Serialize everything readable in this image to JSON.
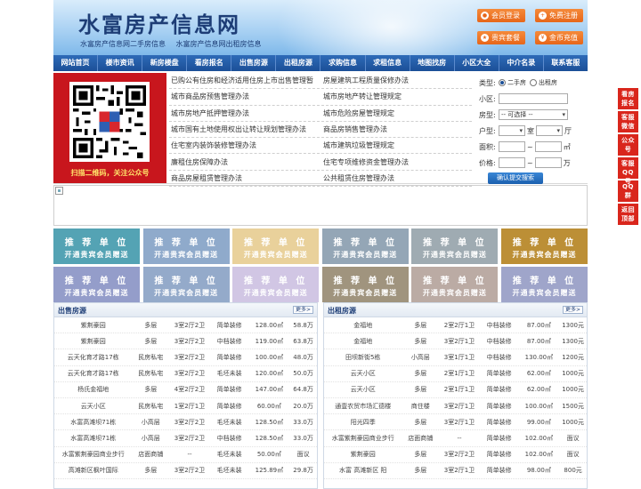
{
  "header": {
    "site_name": "水富房产信息网",
    "taglines": [
      "水富房产信息网二手房信息",
      "水富房产信息网出租房信息"
    ],
    "buttons": [
      {
        "label": "会员登录",
        "icon": "user-icon"
      },
      {
        "label": "免费注册",
        "icon": "register-icon"
      },
      {
        "label": "贵宾套餐",
        "icon": "vip-icon"
      },
      {
        "label": "金币充值",
        "icon": "coin-icon"
      }
    ]
  },
  "nav": [
    "网站首页",
    "楼市资讯",
    "新房楼盘",
    "看房报名",
    "出售房源",
    "出租房源",
    "求购信息",
    "求租信息",
    "地图找房",
    "小区大全",
    "中介名录",
    "联系客服"
  ],
  "qr": {
    "caption": "扫描二维码，关注公众号"
  },
  "links": [
    [
      "已购公有住房和经济适用住房上市出售管理暂",
      "房屋建筑工程质量保修办法"
    ],
    [
      "城市商品房预售管理办法",
      "城市房地产转让管理规定"
    ],
    [
      "城市房地产抵押管理办法",
      "城市危险房屋管理规定"
    ],
    [
      "城市国有土地使用权出让转让规划管理办法",
      "商品房销售管理办法"
    ],
    [
      "住宅室内装饰装修管理办法",
      "城市建筑垃圾管理规定"
    ],
    [
      "廉租住房保障办法",
      "住宅专项维修资金管理办法"
    ],
    [
      "商品房屋租赁管理办法",
      "公共租赁住房管理办法"
    ]
  ],
  "search": {
    "type_label": "类型:",
    "type_options": [
      "二手房",
      "出租房"
    ],
    "selected_type": "二手房",
    "community_label": "小区:",
    "property_label": "房型:",
    "property_value": "-- 可选择 --",
    "layout_label": "户型:",
    "layout_units": [
      "室",
      "厅"
    ],
    "area_label": "面积:",
    "area_unit": "㎡",
    "price_label": "价格:",
    "price_unit": "万",
    "range_sep": "~",
    "submit_label": "确认提交搜索"
  },
  "ads": {
    "line1": "推 荐 单 位",
    "line2": "开通贵宾会员赠送",
    "colors": [
      "#4b9fb0",
      "#8aa6c9",
      "#e8cf96",
      "#8fa2b3",
      "#9aa7ae",
      "#b98a2c",
      "#8f98c8",
      "#8fa6c8",
      "#cfc4e3",
      "#9b8f78",
      "#b8a7a0",
      "#9aa1c8"
    ]
  },
  "sale": {
    "title": "出售房源",
    "more": "更多>",
    "rows": [
      [
        "紫荆豪园",
        "多层",
        "3室2厅2卫",
        "简单装修",
        "128.00㎡",
        "58.8万"
      ],
      [
        "紫荆豪园",
        "多层",
        "3室2厅2卫",
        "中档装修",
        "119.00㎡",
        "63.8万"
      ],
      [
        "云天化育才路17栋",
        "民房私宅",
        "3室2厅2卫",
        "简单装修",
        "100.00㎡",
        "48.0万"
      ],
      [
        "云天化育才路17栋",
        "民房私宅",
        "3室2厅2卫",
        "毛坯未装",
        "120.00㎡",
        "50.0万"
      ],
      [
        "杨氏金福地",
        "多层",
        "4室2厅2卫",
        "简单装修",
        "147.00㎡",
        "64.8万"
      ],
      [
        "云天小区",
        "民房私宅",
        "1室2厅1卫",
        "简单装修",
        "60.00㎡",
        "20.0万"
      ],
      [
        "水富高滩坝71栋",
        "小高层",
        "3室2厅2卫",
        "毛坯未装",
        "128.50㎡",
        "33.0万"
      ],
      [
        "水富高滩坝71栋",
        "小高层",
        "3室2厅2卫",
        "中档装修",
        "128.50㎡",
        "33.0万"
      ],
      [
        "水富紫荆豪园商业步行",
        "店面商铺",
        "--",
        "毛坯未装",
        "50.00㎡",
        "面议"
      ],
      [
        "高滩新区枫叶国际",
        "多层",
        "3室2厅2卫",
        "毛坯未装",
        "125.89㎡",
        "29.8万"
      ]
    ]
  },
  "rent": {
    "title": "出租房源",
    "more": "更多>",
    "rows": [
      [
        "金福地",
        "多层",
        "2室2厅1卫",
        "中档装修",
        "87.00㎡",
        "1300元"
      ],
      [
        "金福地",
        "多层",
        "3室2厅1卫",
        "中档装修",
        "87.00㎡",
        "1300元"
      ],
      [
        "田坝新街5栋",
        "小高层",
        "3室1厅1卫",
        "中档装修",
        "130.00㎡",
        "1200元"
      ],
      [
        "云天小区",
        "多层",
        "2室1厅1卫",
        "简单装修",
        "62.00㎡",
        "1000元"
      ],
      [
        "云天小区",
        "多层",
        "2室1厅1卫",
        "简单装修",
        "62.00㎡",
        "1000元"
      ],
      [
        "通壹农贸市场汇德楼",
        "商住楼",
        "3室2厅1卫",
        "简单装修",
        "100.00㎡",
        "1500元"
      ],
      [
        "阳光四季",
        "多层",
        "3室2厅1卫",
        "简单装修",
        "99.00㎡",
        "1000元"
      ],
      [
        "水富紫荆豪园商业步行",
        "店面商铺",
        "--",
        "简单装修",
        "102.00㎡",
        "面议"
      ],
      [
        "紫荆豪园",
        "多层",
        "3室2厅2卫",
        "简单装修",
        "102.00㎡",
        "面议"
      ],
      [
        "水富 高滩新区 阳",
        "多层",
        "3室2厅1卫",
        "简单装修",
        "98.00㎡",
        "800元"
      ]
    ]
  },
  "side": [
    "看房报名",
    "客服微信",
    "公众号",
    "客服QQ号",
    "QQ群",
    "返回顶部"
  ]
}
